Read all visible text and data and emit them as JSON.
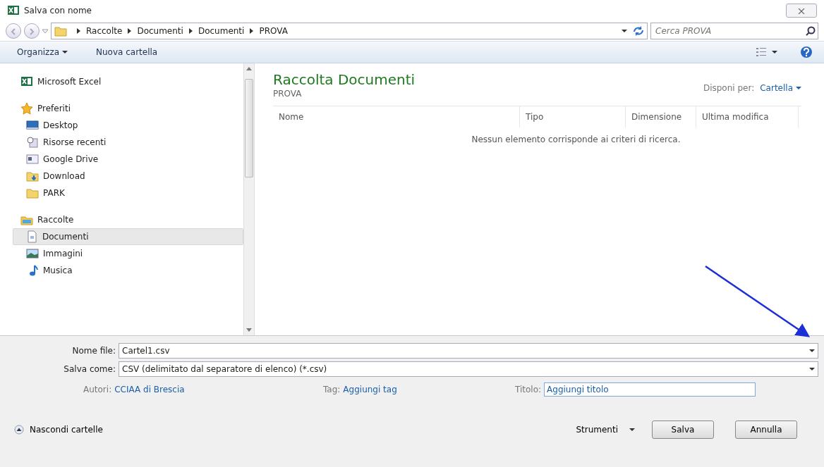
{
  "window": {
    "title": "Salva con nome"
  },
  "address_bar": {
    "breadcrumbs": [
      "Raccolte",
      "Documenti",
      "Documenti",
      "PROVA"
    ]
  },
  "search": {
    "placeholder": "Cerca PROVA"
  },
  "toolbar": {
    "buttons": [
      {
        "label": "Organizza",
        "dropdown": true
      },
      {
        "label": "Nuova cartella",
        "dropdown": false
      }
    ]
  },
  "sidebar": {
    "sections": [
      {
        "label": "Microsoft Excel",
        "kind": "excel",
        "selected": false
      },
      {
        "label": "Preferiti",
        "kind": "star",
        "selected": false,
        "children": [
          {
            "label": "Desktop",
            "kind": "desktop",
            "selected": false
          },
          {
            "label": "Risorse recenti",
            "kind": "recent",
            "selected": false
          },
          {
            "label": "Google Drive",
            "kind": "drive",
            "selected": false
          },
          {
            "label": "Download",
            "kind": "download",
            "selected": false
          },
          {
            "label": "PARK",
            "kind": "folder",
            "selected": false
          }
        ]
      },
      {
        "label": "Raccolte",
        "kind": "library",
        "selected": false,
        "children": [
          {
            "label": "Documenti",
            "kind": "document",
            "selected": true
          },
          {
            "label": "Immagini",
            "kind": "picture",
            "selected": false
          },
          {
            "label": "Musica",
            "kind": "music",
            "selected": false
          }
        ]
      }
    ]
  },
  "content": {
    "title": "Raccolta Documenti",
    "subtitle": "PROVA",
    "arrange_label": "Disponi per:",
    "arrange_value": "Cartella",
    "columns": [
      "Nome",
      "Tipo",
      "Dimensione",
      "Ultima modifica"
    ],
    "empty_message": "Nessun elemento corrisponde ai criteri di ricerca."
  },
  "form": {
    "file_name": {
      "label": "Nome file:",
      "value": "Cartel1.csv"
    },
    "save_as": {
      "label": "Salva come:",
      "value": "CSV (delimitato dal separatore di elenco) (*.csv)"
    },
    "authors": {
      "label": "Autori:",
      "value": "CCIAA di Brescia"
    },
    "tag": {
      "label": "Tag:",
      "value": "Aggiungi tag"
    },
    "doc_title": {
      "label": "Titolo:",
      "value": "Aggiungi titolo"
    }
  },
  "footer": {
    "hide_folders": "Nascondi cartelle",
    "tools": "Strumenti",
    "buttons": [
      "Salva",
      "Annulla"
    ]
  }
}
